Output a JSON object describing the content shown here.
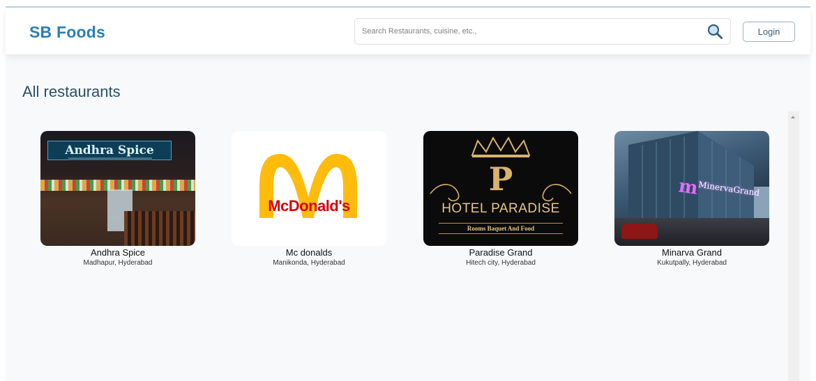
{
  "navbar": {
    "brand": "SB Foods",
    "search": {
      "placeholder": "Search Restaurants, cuisine, etc.,",
      "value": ""
    },
    "login_label": "Login"
  },
  "main": {
    "heading": "All restaurants"
  },
  "restaurants": [
    {
      "name": "Andhra Spice",
      "location": "Madhapur, Hyderabad",
      "image_text": "Andhra Spice"
    },
    {
      "name": "Mc donalds",
      "location": "Manikonda, Hyderabad",
      "image_text": "McDonald's"
    },
    {
      "name": "Paradise Grand",
      "location": "Hitech city, Hyderabad",
      "image_text": "HOTEL PARADISE",
      "image_letter": "P",
      "image_subtext": "Rooms Baquet And Food"
    },
    {
      "name": "Minarva Grand",
      "location": "Kukutpally, Hyderabad",
      "image_text": "MinervaGrand"
    }
  ],
  "colors": {
    "brand": "#2a7fb8",
    "heading": "#2c4e68",
    "mcd_red": "#db0007",
    "mcd_yellow": "#ffbc0d",
    "paradise_gold": "#d9b36a"
  },
  "icons": {
    "search": "search-icon"
  }
}
